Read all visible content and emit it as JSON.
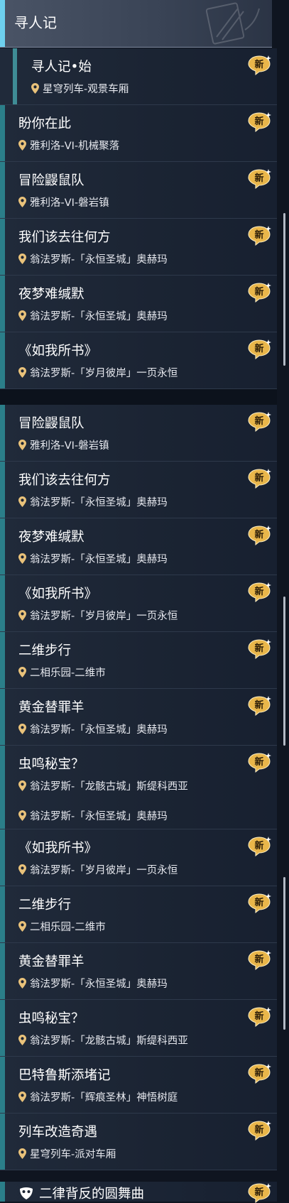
{
  "header": {
    "title": "寻人记"
  },
  "badge_label": "新",
  "sections": [
    {
      "items": [
        {
          "name": "寻人记•始",
          "location": "星穹列车-观景车厢"
        },
        {
          "name": "盼你在此",
          "location": "雅利洛-VI-机械聚落"
        },
        {
          "name": "冒险鼹鼠队",
          "location": "雅利洛-VI-磐岩镇"
        },
        {
          "name": "我们该去往何方",
          "location": "翁法罗斯-「永恒圣城」奥赫玛"
        },
        {
          "name": "夜梦难缄默",
          "location": "翁法罗斯-「永恒圣城」奥赫玛"
        },
        {
          "name": "《如我所书》",
          "location": "翁法罗斯-「岁月彼岸」一页永恒"
        }
      ]
    },
    {
      "items": [
        {
          "name": "冒险鼹鼠队",
          "location": "雅利洛-VI-磐岩镇"
        },
        {
          "name": "我们该去往何方",
          "location": "翁法罗斯-「永恒圣城」奥赫玛"
        },
        {
          "name": "夜梦难缄默",
          "location": "翁法罗斯-「永恒圣城」奥赫玛"
        },
        {
          "name": "《如我所书》",
          "location": "翁法罗斯-「岁月彼岸」一页永恒"
        },
        {
          "name": "二维步行",
          "location": "二相乐园-二维市"
        },
        {
          "name": "黄金替罪羊",
          "location": "翁法罗斯-「永恒圣城」奥赫玛"
        },
        {
          "name": "虫鸣秘宝？",
          "location": "翁法罗斯-「龙骸古城」斯缇科西亚"
        }
      ]
    },
    {
      "partial_location": "翁法罗斯-「永恒圣城」奥赫玛",
      "items": [
        {
          "name": "《如我所书》",
          "location": "翁法罗斯-「岁月彼岸」一页永恒"
        },
        {
          "name": "二维步行",
          "location": "二相乐园-二维市"
        },
        {
          "name": "黄金替罪羊",
          "location": "翁法罗斯-「永恒圣城」奥赫玛"
        },
        {
          "name": "虫鸣秘宝？",
          "location": "翁法罗斯-「龙骸古城」斯缇科西亚"
        },
        {
          "name": "巴特鲁斯添堵记",
          "location": "翁法罗斯-「辉痕圣林」神悟树庭"
        },
        {
          "name": "列车改造奇遇",
          "location": "星穹列车-派对车厢"
        }
      ]
    }
  ],
  "bottom_item": {
    "name": "二律背反的圆舞曲"
  },
  "colors": {
    "accent": "#6ed0ee",
    "row_bar": "#2b7e89",
    "badge": "#e9b64a"
  }
}
